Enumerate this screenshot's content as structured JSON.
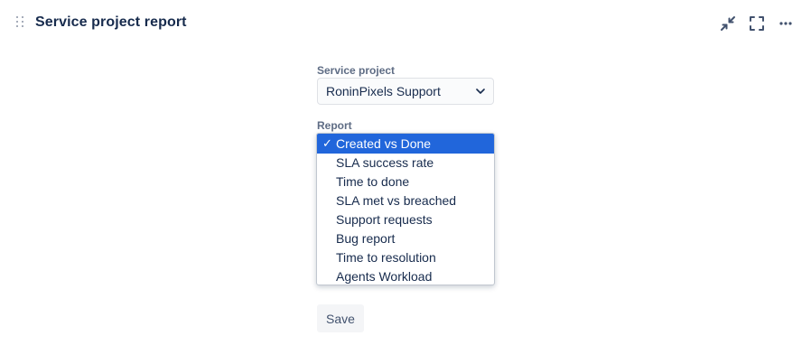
{
  "header": {
    "title": "Service project report",
    "actions": [
      {
        "icon": "minimize-icon"
      },
      {
        "icon": "fullscreen-icon"
      },
      {
        "icon": "more-icon"
      }
    ]
  },
  "form": {
    "service_project": {
      "label": "Service project",
      "value": "RoninPixels Support"
    },
    "report": {
      "label": "Report",
      "options": [
        {
          "label": "Created vs Done",
          "selected": true
        },
        {
          "label": "SLA success rate",
          "selected": false
        },
        {
          "label": "Time to done",
          "selected": false
        },
        {
          "label": "SLA met vs breached",
          "selected": false
        },
        {
          "label": "Support requests",
          "selected": false
        },
        {
          "label": "Bug report",
          "selected": false
        },
        {
          "label": "Time to resolution",
          "selected": false
        },
        {
          "label": "Agents Workload",
          "selected": false
        }
      ],
      "check_glyph": "✓"
    },
    "save_label": "Save"
  },
  "colors": {
    "selected_bg": "#2166db",
    "title": "#172b4d",
    "label": "#5e6c84"
  }
}
